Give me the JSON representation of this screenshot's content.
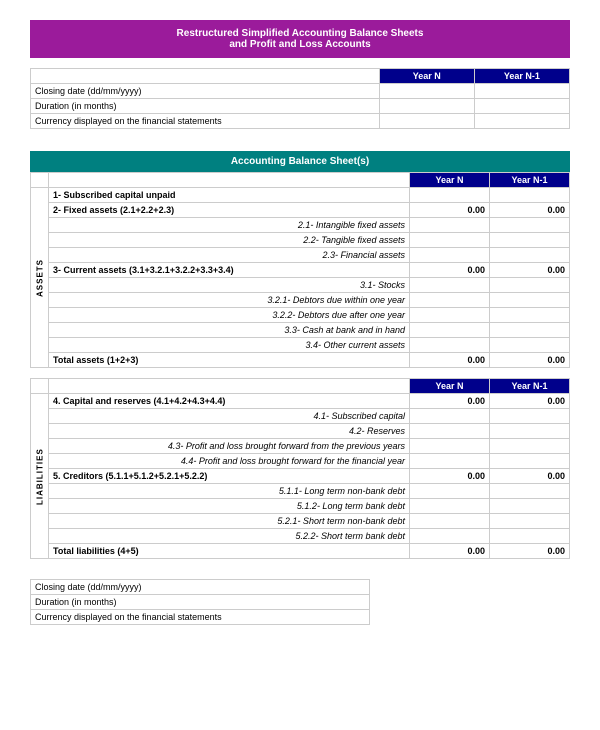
{
  "mainTitle": {
    "line1": "Restructured Simplified Accounting Balance Sheets",
    "line2": "and Profit and Loss Accounts"
  },
  "topInfoTable": {
    "headers": [
      "",
      "Year N",
      "Year N-1"
    ],
    "rows": [
      {
        "label": "Closing date (dd/mm/yyyy)",
        "yearN": "",
        "yearN1": ""
      },
      {
        "label": "Duration (in months)",
        "yearN": "",
        "yearN1": ""
      },
      {
        "label": "Currency displayed on the financial statements",
        "yearN": "",
        "yearN1": ""
      }
    ]
  },
  "accountingSection": {
    "title": "Accounting Balance Sheet(s)",
    "colHeaders": [
      "Year N",
      "Year N-1"
    ],
    "assets": {
      "sideLabel": "ASSETS",
      "rows": [
        {
          "type": "bold",
          "label": "1- Subscribed capital unpaid",
          "yearN": "",
          "yearN1": "",
          "indent": false
        },
        {
          "type": "bold",
          "label": "2- Fixed assets (2.1+2.2+2.3)",
          "yearN": "0.00",
          "yearN1": "0.00",
          "indent": false
        },
        {
          "type": "italic",
          "label": "2.1- Intangible fixed assets",
          "yearN": "",
          "yearN1": "",
          "indent": true
        },
        {
          "type": "italic",
          "label": "2.2- Tangible fixed assets",
          "yearN": "",
          "yearN1": "",
          "indent": true
        },
        {
          "type": "italic",
          "label": "2.3- Financial assets",
          "yearN": "",
          "yearN1": "",
          "indent": true
        },
        {
          "type": "bold",
          "label": "3- Current assets (3.1+3.2.1+3.2.2+3.3+3.4)",
          "yearN": "0.00",
          "yearN1": "0.00",
          "indent": false
        },
        {
          "type": "italic",
          "label": "3.1- Stocks",
          "yearN": "",
          "yearN1": "",
          "indent": true
        },
        {
          "type": "italic",
          "label": "3.2.1- Debtors due within one year",
          "yearN": "",
          "yearN1": "",
          "indent": true
        },
        {
          "type": "italic",
          "label": "3.2.2- Debtors due after one year",
          "yearN": "",
          "yearN1": "",
          "indent": true
        },
        {
          "type": "italic",
          "label": "3.3- Cash at bank and in hand",
          "yearN": "",
          "yearN1": "",
          "indent": true
        },
        {
          "type": "italic",
          "label": "3.4- Other current assets",
          "yearN": "",
          "yearN1": "",
          "indent": true
        },
        {
          "type": "total",
          "label": "Total assets (1+2+3)",
          "yearN": "0.00",
          "yearN1": "0.00",
          "indent": false
        }
      ]
    },
    "liabilities": {
      "sideLabel": "LIABILITIES",
      "rows": [
        {
          "type": "bold",
          "label": "4. Capital and reserves (4.1+4.2+4.3+4.4)",
          "yearN": "0.00",
          "yearN1": "0.00",
          "indent": false
        },
        {
          "type": "italic",
          "label": "4.1- Subscribed capital",
          "yearN": "",
          "yearN1": "",
          "indent": true
        },
        {
          "type": "italic",
          "label": "4.2- Reserves",
          "yearN": "",
          "yearN1": "",
          "indent": true
        },
        {
          "type": "italic",
          "label": "4.3- Profit and loss brought forward from the previous years",
          "yearN": "",
          "yearN1": "",
          "indent": true
        },
        {
          "type": "italic",
          "label": "4.4- Profit and loss brought forward for the financial year",
          "yearN": "",
          "yearN1": "",
          "indent": true
        },
        {
          "type": "bold",
          "label": "5. Creditors (5.1.1+5.1.2+5.2.1+5.2.2)",
          "yearN": "0.00",
          "yearN1": "0.00",
          "indent": false
        },
        {
          "type": "italic",
          "label": "5.1.1- Long term non-bank debt",
          "yearN": "",
          "yearN1": "",
          "indent": true
        },
        {
          "type": "italic",
          "label": "5.1.2- Long term bank debt",
          "yearN": "",
          "yearN1": "",
          "indent": true
        },
        {
          "type": "italic",
          "label": "5.2.1- Short term non-bank debt",
          "yearN": "",
          "yearN1": "",
          "indent": true
        },
        {
          "type": "italic",
          "label": "5.2.2- Short term bank debt",
          "yearN": "",
          "yearN1": "",
          "indent": true
        },
        {
          "type": "total",
          "label": "Total liabilities (4+5)",
          "yearN": "0.00",
          "yearN1": "0.00",
          "indent": false
        }
      ]
    }
  },
  "bottomInfoTable": {
    "rows": [
      {
        "label": "Closing date (dd/mm/yyyy)"
      },
      {
        "label": "Duration (in months)"
      },
      {
        "label": "Currency displayed on the financial statements"
      }
    ]
  }
}
